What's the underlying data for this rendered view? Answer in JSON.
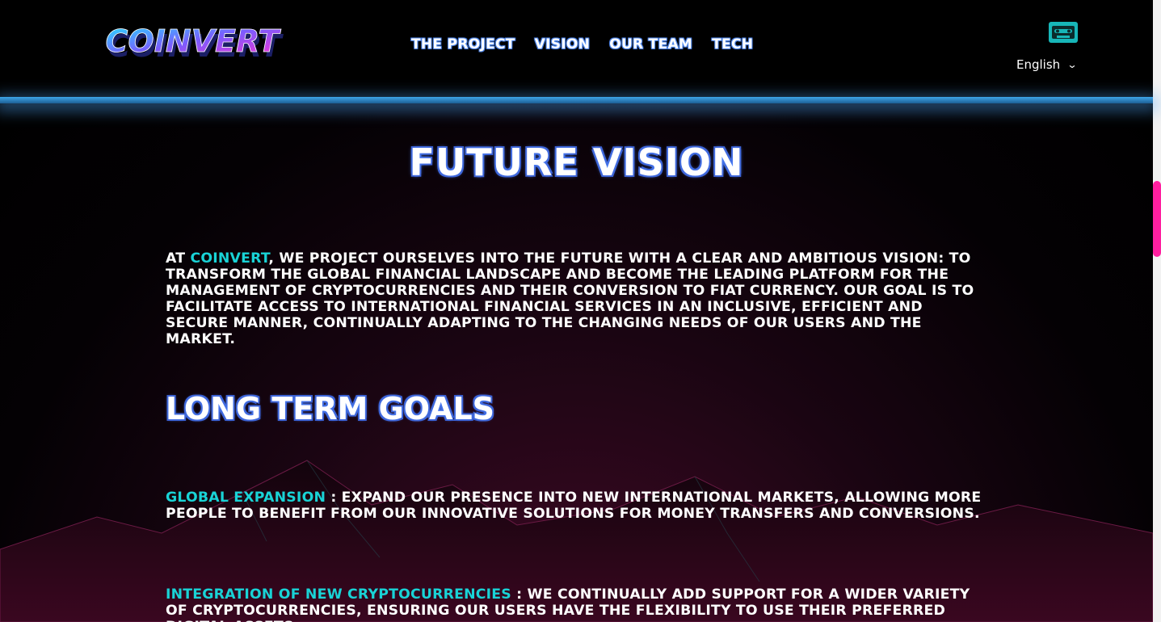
{
  "header": {
    "logo_text": "COINVERT",
    "nav": [
      {
        "label": "THE PROJECT"
      },
      {
        "label": "VISION"
      },
      {
        "label": "OUR TEAM"
      },
      {
        "label": "TECH"
      }
    ],
    "tape_icon": "cassette-tape-icon",
    "language": {
      "selected": "English",
      "icon": "chevron-down-icon"
    }
  },
  "main": {
    "title": "FUTURE VISION",
    "intro": {
      "prefix": "AT ",
      "brand": "COINVERT",
      "text": ", WE PROJECT OURSELVES INTO THE FUTURE WITH A CLEAR AND AMBITIOUS VISION: TO TRANSFORM THE GLOBAL FINANCIAL LANDSCAPE AND BECOME THE LEADING PLATFORM FOR THE MANAGEMENT OF CRYPTOCURRENCIES AND THEIR CONVERSION TO FIAT CURRENCY. OUR GOAL IS TO FACILITATE ACCESS TO INTERNATIONAL FINANCIAL SERVICES IN AN INCLUSIVE, EFFICIENT AND SECURE MANNER, CONTINUALLY ADAPTING TO THE CHANGING NEEDS OF OUR USERS AND THE MARKET."
    },
    "section_title": "LONG TERM GOALS",
    "goals": [
      {
        "title": "GLOBAL EXPANSION",
        "text": " : EXPAND OUR PRESENCE INTO NEW INTERNATIONAL MARKETS, ALLOWING MORE PEOPLE TO BENEFIT FROM OUR INNOVATIVE SOLUTIONS FOR MONEY TRANSFERS AND CONVERSIONS."
      },
      {
        "title": "INTEGRATION OF NEW CRYPTOCURRENCIES",
        "text": " : WE CONTINUALLY ADD SUPPORT FOR A WIDER VARIETY OF CRYPTOCURRENCIES, ENSURING OUR USERS HAVE THE FLEXIBILITY TO USE THEIR PREFERRED DIGITAL ASSETS."
      }
    ]
  },
  "colors": {
    "accent_cyan": "#19d3d6",
    "scrollbar_pink": "#ff1fa0",
    "header_glow_blue": "#3ea5e8"
  }
}
